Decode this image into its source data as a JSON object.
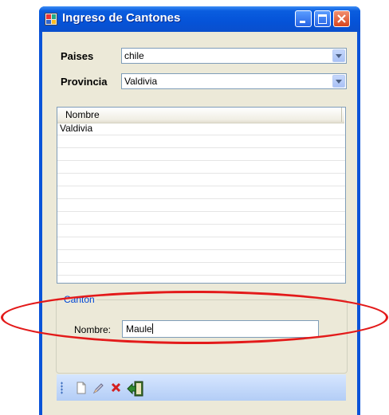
{
  "window": {
    "title": "Ingreso de Cantones"
  },
  "form": {
    "paises_label": "Paises",
    "paises_value": "chile",
    "provincia_label": "Provincia",
    "provincia_value": "Valdivia"
  },
  "list": {
    "column_header": "Nombre",
    "rows": [
      "Valdivia",
      "",
      "",
      "",
      "",
      "",
      "",
      "",
      "",
      "",
      "",
      ""
    ]
  },
  "canton_group": {
    "title": "Canton",
    "nombre_label": "Nombre:",
    "nombre_value": "Maule"
  },
  "toolbar": {
    "icons": [
      "new-document-icon",
      "edit-pencil-icon",
      "delete-x-icon",
      "exit-door-icon"
    ]
  },
  "annotation": {
    "color": "#e31a1a"
  }
}
